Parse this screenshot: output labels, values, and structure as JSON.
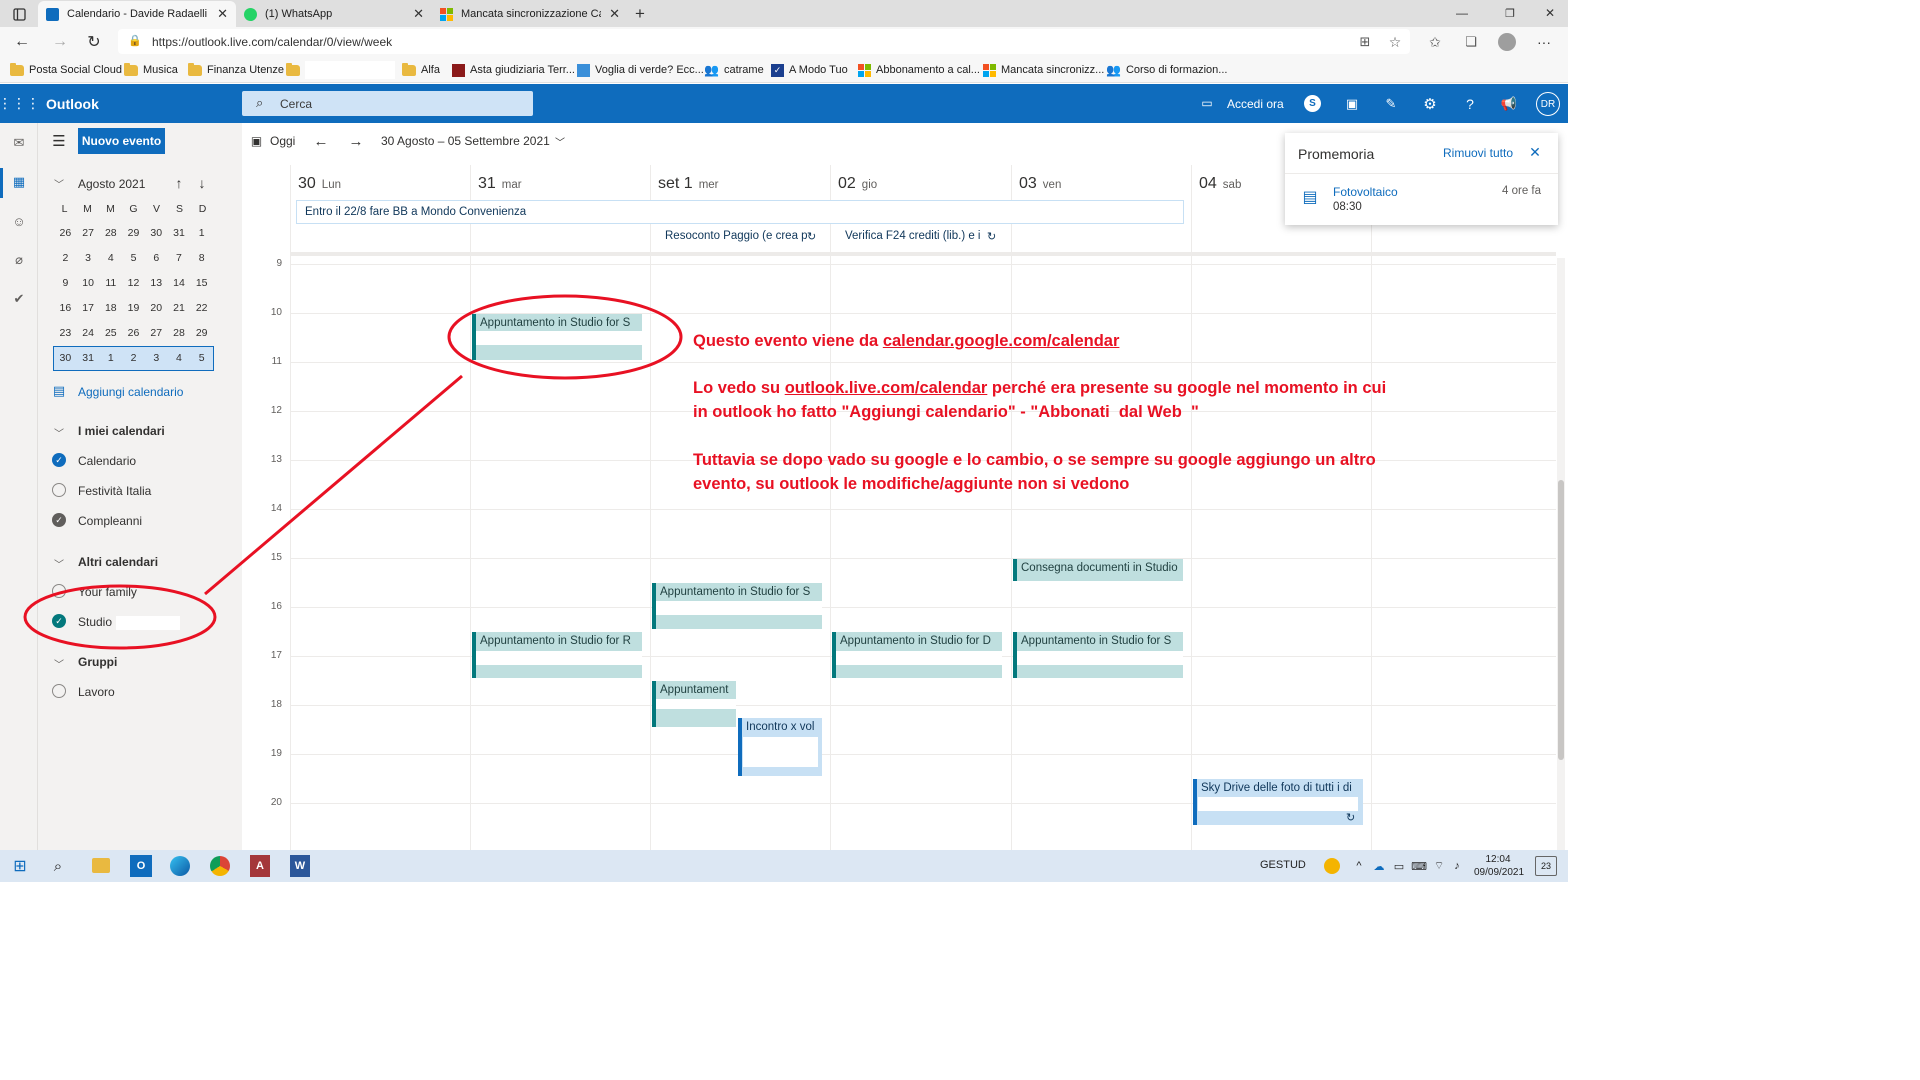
{
  "browser": {
    "tabs": [
      {
        "title": "Calendario - Davide Radaelli - O",
        "color": "#0f6cbd"
      },
      {
        "title": "(1) WhatsApp",
        "color": "#25d366"
      },
      {
        "title": "Mancata sincronizzazione Calend",
        "color": "#f25022"
      }
    ],
    "url": "https://outlook.live.com/calendar/0/view/week",
    "favorites": [
      {
        "label": "Posta Social Cloud",
        "icon": "folder-icon"
      },
      {
        "label": "Musica",
        "icon": "folder-icon"
      },
      {
        "label": "Finanza Utenze",
        "icon": "folder-icon"
      },
      {
        "label": "",
        "icon": "folder-icon"
      },
      {
        "label": "Alfa",
        "icon": "folder-icon"
      },
      {
        "label": "Asta giudiziaria Terr...",
        "icon": "red-logo-icon"
      },
      {
        "label": "Voglia di verde? Ecc...",
        "icon": "blue-logo-icon"
      },
      {
        "label": "catrame",
        "icon": "people-icon"
      },
      {
        "label": "A Modo Tuo",
        "icon": "check-logo-icon"
      },
      {
        "label": "Abbonamento a cal...",
        "icon": "microsoft-logo-icon"
      },
      {
        "label": "Mancata sincronizz...",
        "icon": "microsoft-logo-icon"
      },
      {
        "label": "Corso di formazion...",
        "icon": "people-icon"
      }
    ]
  },
  "header": {
    "app_name": "Outlook",
    "search_placeholder": "Cerca",
    "meet_label": "Accedi ora",
    "avatar_initials": "DR"
  },
  "toolbar": {
    "new_event": "Nuovo evento",
    "today": "Oggi",
    "date_range": "30 Agosto – 05 Settembre 2021"
  },
  "mini_calendar": {
    "month": "Agosto 2021",
    "weekdays": [
      "L",
      "M",
      "M",
      "G",
      "V",
      "S",
      "D"
    ],
    "weeks": [
      [
        "26",
        "27",
        "28",
        "29",
        "30",
        "31",
        "1"
      ],
      [
        "2",
        "3",
        "4",
        "5",
        "6",
        "7",
        "8"
      ],
      [
        "9",
        "10",
        "11",
        "12",
        "13",
        "14",
        "15"
      ],
      [
        "16",
        "17",
        "18",
        "19",
        "20",
        "21",
        "22"
      ],
      [
        "23",
        "24",
        "25",
        "26",
        "27",
        "28",
        "29"
      ],
      [
        "30",
        "31",
        "1",
        "2",
        "3",
        "4",
        "5"
      ]
    ]
  },
  "sidebar": {
    "add_calendar": "Aggiungi calendario",
    "groups": [
      {
        "title": "I miei calendari",
        "items": [
          {
            "label": "Calendario",
            "checked": true,
            "color": "#0f6cbd"
          },
          {
            "label": "Festività Italia",
            "checked": false,
            "color": "#8a8886"
          },
          {
            "label": "Compleanni",
            "checked": true,
            "color": "#605e5c"
          }
        ]
      },
      {
        "title": "Altri calendari",
        "items": [
          {
            "label": "Your family",
            "checked": false,
            "color": "#8a8886"
          },
          {
            "label": "Studio",
            "checked": true,
            "color": "#03787c"
          }
        ]
      },
      {
        "title": "Gruppi",
        "items": [
          {
            "label": "Lavoro",
            "checked": false,
            "color": "#8a8886"
          }
        ]
      }
    ]
  },
  "week": {
    "days": [
      {
        "num": "30",
        "name": "Lun"
      },
      {
        "num": "31",
        "name": "mar"
      },
      {
        "num": "set 1",
        "name": "mer"
      },
      {
        "num": "02",
        "name": "gio"
      },
      {
        "num": "03",
        "name": "ven"
      },
      {
        "num": "04",
        "name": "sab"
      }
    ],
    "hours": [
      "9",
      "10",
      "11",
      "12",
      "13",
      "14",
      "15",
      "16",
      "17",
      "18",
      "19",
      "20"
    ],
    "allday_events": [
      "Entro il 22/8 fare BB a Mondo Convenienza",
      "Resoconto Paggio (e crea p",
      "Verifica F24 crediti (lib.) e i"
    ],
    "events": [
      "Appuntamento in Studio for S",
      "Consegna documenti in Studio",
      "Appuntamento in Studio for S",
      "Appuntamento in Studio for R",
      "Appuntamento in Studio for D",
      "Appuntamento in Studio for S",
      "Appuntament",
      "Incontro x vol",
      "Sky Drive delle foto di tutti i di"
    ]
  },
  "reminder": {
    "title": "Promemoria",
    "dismiss_all": "Rimuovi tutto",
    "item_title": "Fotovoltaico",
    "item_time": "08:30",
    "item_due": "4 ore fa"
  },
  "annotation": {
    "line1_prefix": "Questo evento viene da ",
    "line1_link": "calendar.google.com/calendar",
    "line2_prefix": "Lo vedo su ",
    "line2_link": "outlook.live.com/calendar",
    "line2_suffix": " perché era presente su google nel momento in cui",
    "line3": "in outlook ho fatto \"Aggiungi calendario\" - \"Abbonati  dal Web  \"",
    "line4": "Tuttavia se dopo vado su google e lo cambio, o se sempre su google aggiungo un altro",
    "line5": "evento, su outlook le modifiche/aggiunte non si vedono",
    "color": "#e81123"
  },
  "taskbar": {
    "user": "GESTUD",
    "time": "12:04",
    "date": "09/09/2021",
    "notifications": "23"
  }
}
